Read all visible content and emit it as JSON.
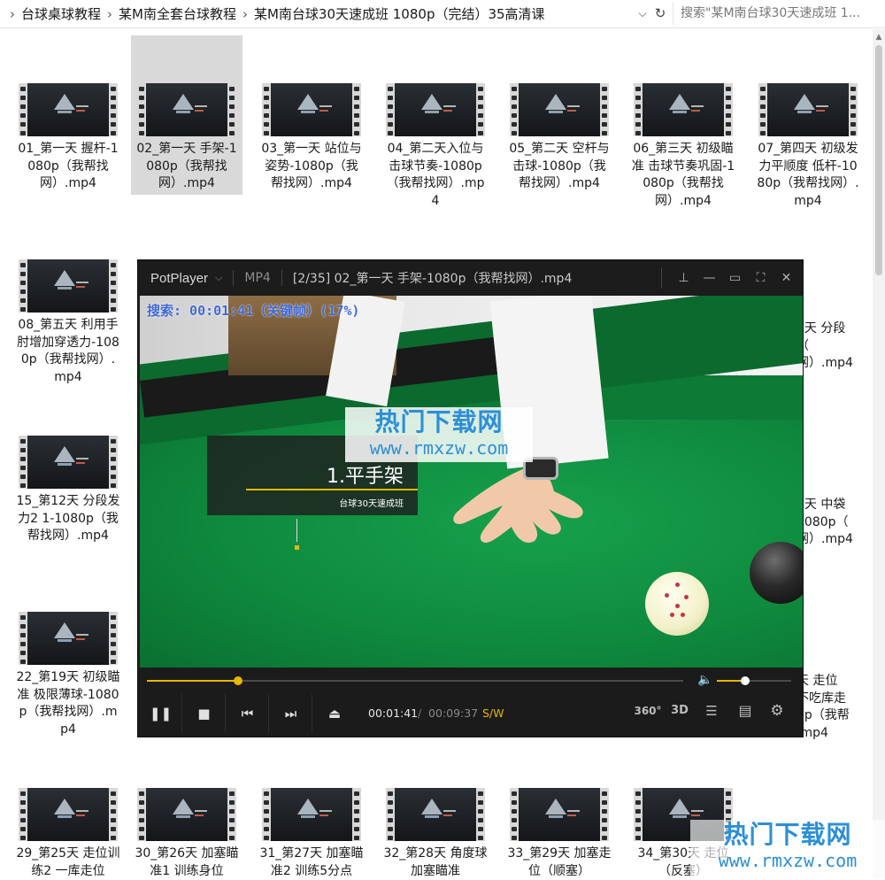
{
  "breadcrumb": [
    "台球桌球教程",
    "某M南全套台球教程",
    "某M南台球30天速成班  1080p（完结）35高清课"
  ],
  "breadcrumb_separator": "›",
  "search": {
    "placeholder": "搜索\"某M南台球30天速成班  1..."
  },
  "files": [
    {
      "name": "01_第一天 握杆-1080p（我帮找网）.mp4"
    },
    {
      "name": "02_第一天 手架-1080p（我帮找网）.mp4",
      "selected": true
    },
    {
      "name": "03_第一天 站位与姿势-1080p（我帮找网）.mp4"
    },
    {
      "name": "04_第二天入位与击球节奏-1080p（我帮找网）.mp4"
    },
    {
      "name": "05_第二天 空杆与击球-1080p（我帮找网）.mp4"
    },
    {
      "name": "06_第三天 初级瞄准 击球节奏巩固-1080p（我帮找网）.mp4"
    },
    {
      "name": "07_第四天 初级发力平顺度 低杆-1080p（我帮找网）.mp4"
    },
    {
      "name": "08_第五天 利用手肘增加穿透力-1080p（我帮找网）.mp4"
    },
    {
      "name": "15_第12天 分段发力2 1-1080p（我帮找网）.mp4"
    },
    {
      "name": "22_第19天 初级瞄准 极限薄球-1080p（我帮找网）.mp4"
    },
    {
      "name": "29_第25天 走位训练2 一库走位"
    },
    {
      "name": "30_第26天 加塞瞄准1 训练身位"
    },
    {
      "name": "31_第27天 加塞瞄准2 训练5分点"
    },
    {
      "name": "32_第28天 角度球加塞瞄准"
    },
    {
      "name": "33_第29天 加塞走位（顺塞）"
    },
    {
      "name": "34_第30天 走位（反塞）"
    }
  ],
  "partial_names": {
    "row2": "1天 分段\n（\n网）.mp4",
    "row3": "8天 中袋\n1080p（\n网）.mp4",
    "row4": "天 走位\n不吃库走\n0p（我帮\n.mp4"
  },
  "player": {
    "brand": "PotPlayer",
    "format": "MP4",
    "title": "[2/35] 02_第一天 手架-1080p（我帮找网）.mp4",
    "seek_osd": "搜索: 00:01:41（关键帧）(17%)",
    "lesson_title": "1.平手架",
    "lesson_subtitle": "台球30天速成班",
    "time_current": "00:01:41",
    "time_sep": "/",
    "time_total": "00:09:37",
    "mode": "S/W",
    "progress": 0.17,
    "volume": 0.38,
    "label_360": "360°",
    "label_3d": "3D"
  },
  "watermark": {
    "line1": "热门下载网",
    "line2": "www.rmxzw.com"
  },
  "colors": {
    "accent": "#e6b800",
    "osd": "#3f69d6",
    "watermark": "#2d8fd6",
    "selection": "#d9d9d9"
  }
}
